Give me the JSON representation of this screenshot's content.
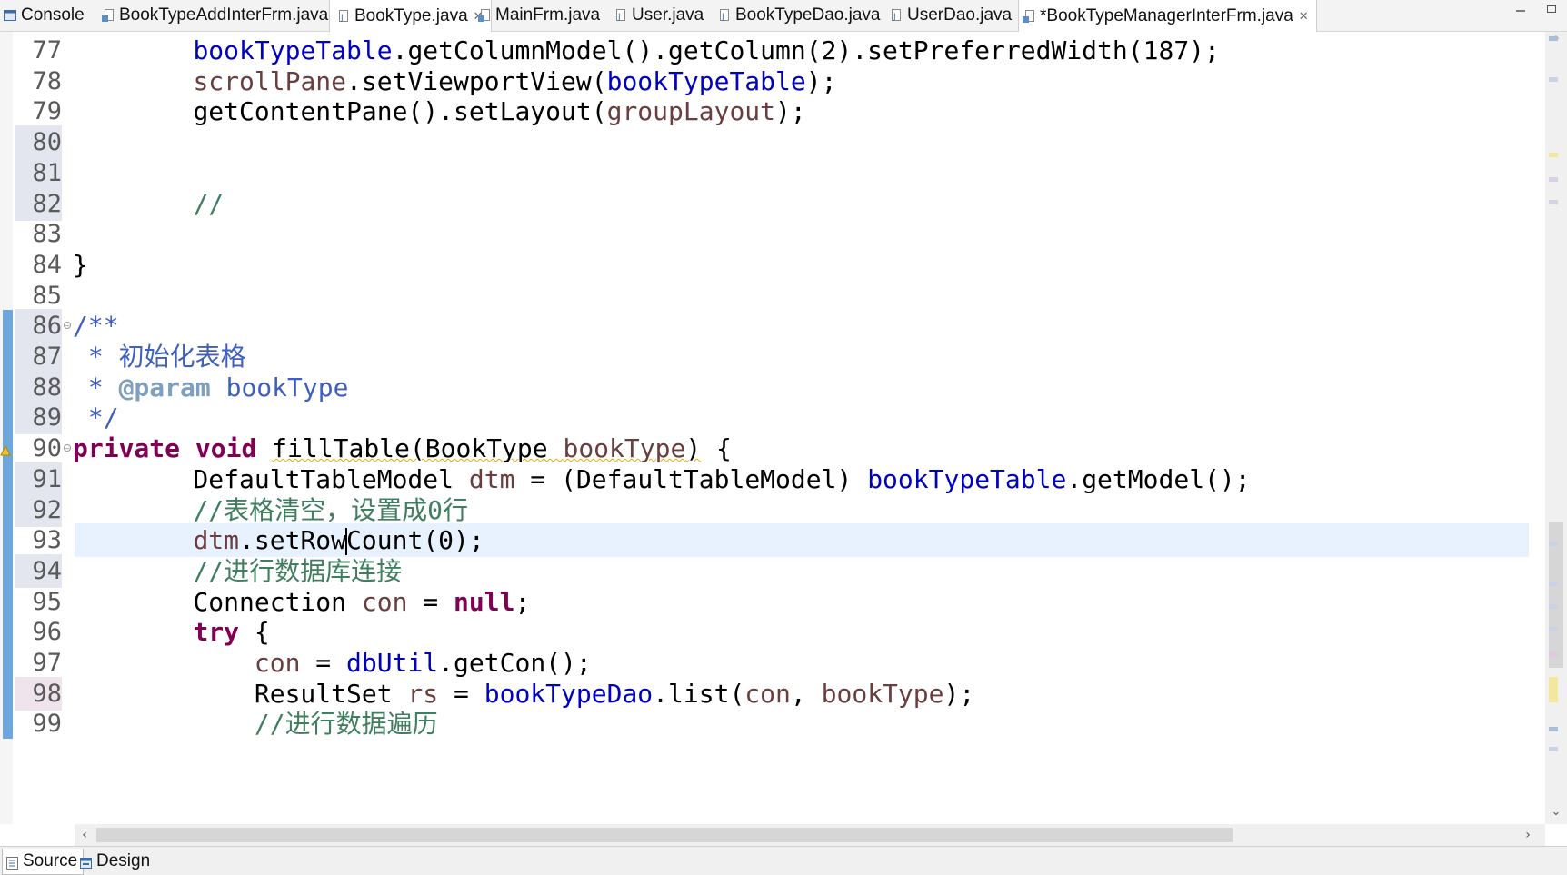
{
  "tabs": [
    {
      "label": "Console",
      "icon": "console-icon",
      "active": false,
      "closable": false
    },
    {
      "label": "BookTypeAddInterFrm.java",
      "icon": "java-frame-file-icon",
      "active": false,
      "closable": false
    },
    {
      "label": "BookType.java",
      "icon": "java-file-icon",
      "active": false,
      "closable": true
    },
    {
      "label": "MainFrm.java",
      "icon": "java-frame-file-icon",
      "active": false,
      "closable": false
    },
    {
      "label": "User.java",
      "icon": "java-file-icon",
      "active": false,
      "closable": false
    },
    {
      "label": "BookTypeDao.java",
      "icon": "java-file-icon",
      "active": false,
      "closable": false
    },
    {
      "label": "UserDao.java",
      "icon": "java-file-icon",
      "active": false,
      "closable": false
    },
    {
      "label": "*BookTypeManagerInterFrm.java",
      "icon": "java-frame-file-icon",
      "active": true,
      "closable": true
    }
  ],
  "editor": {
    "lines": {
      "77": {
        "num": "77",
        "tokens": [
          [
            "    ",
            ""
          ],
          [
            "bookTypeTable",
            "fld"
          ],
          [
            ".getColumnModel().getColumn(2).setPreferredWidth(187);",
            ""
          ]
        ]
      },
      "78": {
        "num": "78",
        "tokens": [
          [
            "    ",
            ""
          ],
          [
            "scrollPane",
            "var"
          ],
          [
            ".setViewportView(",
            ""
          ],
          [
            "bookTypeTable",
            "fld"
          ],
          [
            ");",
            ""
          ]
        ]
      },
      "79": {
        "num": "79",
        "tokens": [
          [
            "    ",
            ""
          ],
          [
            "getContentPane().setLayout(",
            ""
          ],
          [
            "groupLayout",
            "var"
          ],
          [
            ");",
            ""
          ]
        ]
      },
      "80": {
        "num": "80",
        "tokens": []
      },
      "81": {
        "num": "81",
        "tokens": []
      },
      "82": {
        "num": "82",
        "tokens": [
          [
            "    ",
            ""
          ],
          [
            "//",
            "cm"
          ]
        ]
      },
      "83": {
        "num": "83",
        "tokens": []
      },
      "84": {
        "num": "84",
        "tokens": [
          [
            "}",
            ""
          ]
        ]
      },
      "85": {
        "num": "85",
        "tokens": []
      },
      "86": {
        "num": "86",
        "tokens": [
          [
            "/**",
            "jd"
          ]
        ]
      },
      "87": {
        "num": "87",
        "tokens": [
          [
            " * 初始化表格",
            "jd"
          ]
        ]
      },
      "88": {
        "num": "88",
        "tokens": [
          [
            " * ",
            "jd"
          ],
          [
            "@param",
            "jdtag"
          ],
          [
            " bookType",
            "jd"
          ]
        ]
      },
      "89": {
        "num": "89",
        "tokens": [
          [
            " */",
            "jd"
          ]
        ]
      },
      "90": {
        "num": "90",
        "tokens": [
          [
            "private",
            "kw"
          ],
          [
            " ",
            ""
          ],
          [
            "void",
            "kw"
          ],
          [
            " ",
            ""
          ],
          [
            "fillTable(BookType ",
            "warn"
          ],
          [
            "bookType",
            "var warn"
          ],
          [
            ")",
            "warn"
          ],
          [
            " {",
            ""
          ]
        ]
      },
      "91": {
        "num": "91",
        "tokens": [
          [
            "    DefaultTableModel ",
            ""
          ],
          [
            "dtm",
            "var"
          ],
          [
            " = (DefaultTableModel) ",
            ""
          ],
          [
            "bookTypeTable",
            "fld"
          ],
          [
            ".getModel();",
            ""
          ]
        ]
      },
      "92": {
        "num": "92",
        "tokens": [
          [
            "    ",
            ""
          ],
          [
            "//表格清空，设置成0行",
            "cm"
          ]
        ]
      },
      "93": {
        "num": "93",
        "tokens": [
          [
            "    ",
            ""
          ],
          [
            "dtm",
            "var"
          ],
          [
            ".setRow",
            ""
          ],
          [
            "|",
            "caret"
          ],
          [
            "Count(0);",
            ""
          ]
        ]
      },
      "94": {
        "num": "94",
        "tokens": [
          [
            "    ",
            ""
          ],
          [
            "//进行数据库连接",
            "cm"
          ]
        ]
      },
      "95": {
        "num": "95",
        "tokens": [
          [
            "    Connection ",
            ""
          ],
          [
            "con",
            "var"
          ],
          [
            " = ",
            ""
          ],
          [
            "null",
            "kw"
          ],
          [
            ";",
            ""
          ]
        ]
      },
      "96": {
        "num": "96",
        "tokens": [
          [
            "    ",
            ""
          ],
          [
            "try",
            "kw"
          ],
          [
            " {",
            ""
          ]
        ]
      },
      "97": {
        "num": "97",
        "tokens": [
          [
            "        ",
            ""
          ],
          [
            "con",
            "var"
          ],
          [
            " = ",
            ""
          ],
          [
            "dbUtil",
            "fld"
          ],
          [
            ".getCon();",
            ""
          ]
        ]
      },
      "98": {
        "num": "98",
        "tokens": [
          [
            "        ResultSet ",
            ""
          ],
          [
            "rs",
            "var"
          ],
          [
            " = ",
            ""
          ],
          [
            "bookTypeDao",
            "fld"
          ],
          [
            ".list(",
            ""
          ],
          [
            "con",
            "var"
          ],
          [
            ", ",
            ""
          ],
          [
            "bookType",
            "var"
          ],
          [
            ");",
            ""
          ]
        ]
      },
      "99": {
        "num": "99",
        "tokens": [
          [
            "        ",
            ""
          ],
          [
            "//进行数据遍历",
            "cm"
          ]
        ]
      }
    },
    "current_line": "93"
  },
  "bottom_tabs": [
    {
      "label": "Source",
      "active": true
    },
    {
      "label": "Design",
      "active": false
    }
  ],
  "colors": {
    "keyword": "#7f0055",
    "field": "#0000c0",
    "local_variable": "#6a3e3e",
    "comment": "#3f7f5f",
    "javadoc": "#3f5fbf",
    "current_line": "#e8f2fe",
    "quick_diff_bar": "#6ea6de"
  }
}
